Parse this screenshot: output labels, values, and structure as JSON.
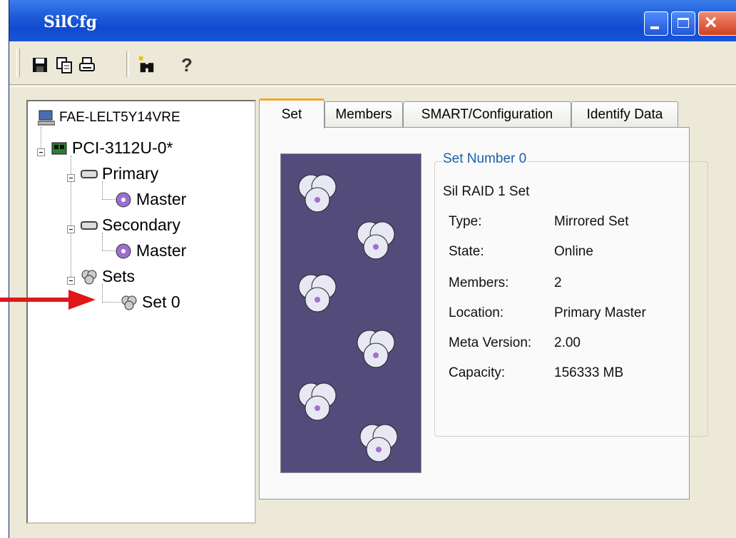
{
  "window": {
    "title": "SilCfg"
  },
  "toolbar": {
    "buttons": [
      {
        "icon": "save-icon"
      },
      {
        "icon": "copy-icon"
      },
      {
        "icon": "print-icon"
      },
      {
        "icon": "find-icon"
      },
      {
        "icon": "help-icon",
        "glyph": "?"
      }
    ]
  },
  "tree": {
    "computer": "FAE-LELT5Y14VRE",
    "controller": "PCI-3112U-0*",
    "primary": "Primary",
    "primary_master": "Master",
    "secondary": "Secondary",
    "secondary_master": "Master",
    "sets": "Sets",
    "set0": "Set 0"
  },
  "tabs": [
    "Set",
    "Members",
    "SMART/Configuration",
    "Identify Data"
  ],
  "set_info": {
    "group_title": "Set Number 0",
    "name": "Sil RAID 1 Set",
    "rows": [
      {
        "label": "Type:",
        "value": "Mirrored Set"
      },
      {
        "label": "State:",
        "value": "Online"
      },
      {
        "label": "Members:",
        "value": "2"
      },
      {
        "label": "Location:",
        "value": "Primary Master"
      },
      {
        "label": "Meta Version:",
        "value": "2.00"
      },
      {
        "label": "Capacity:",
        "value": "156333 MB"
      }
    ]
  },
  "colors": {
    "titlebar": "#1e5bd6",
    "art_bg": "#534c7a",
    "arrow": "#e01818",
    "group_title": "#1a5fa8"
  }
}
